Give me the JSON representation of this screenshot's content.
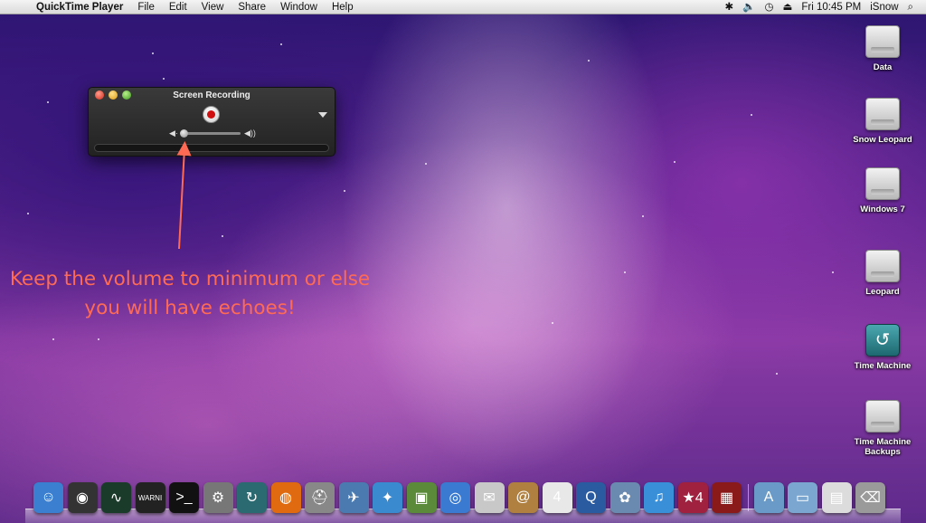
{
  "menubar": {
    "apple_icon": "apple-icon",
    "app_name": "QuickTime Player",
    "items": [
      "File",
      "Edit",
      "View",
      "Share",
      "Window",
      "Help"
    ],
    "status": {
      "clock": "Fri 10:45 PM",
      "user": "iSnow",
      "icons": [
        "gear-status-icon",
        "volume-icon",
        "time-machine-icon",
        "eject-icon",
        "spotlight-icon"
      ]
    }
  },
  "qt_window": {
    "title": "Screen Recording",
    "volume_level": 0
  },
  "annotation": {
    "text": "Keep the volume to minimum or else you will have echoes!",
    "color": "#ff6a55"
  },
  "desktop_icons": [
    {
      "label": "Data",
      "type": "disk"
    },
    {
      "label": "Snow Leopard",
      "type": "disk"
    },
    {
      "label": "Windows 7",
      "type": "disk"
    },
    {
      "label": "Leopard",
      "type": "disk"
    },
    {
      "label": "Time Machine",
      "type": "time-machine"
    },
    {
      "label": "Time Machine Backups",
      "type": "disk"
    }
  ],
  "dock": {
    "items": [
      {
        "name": "finder-icon",
        "glyph": "☺",
        "color": "#3a7fd0"
      },
      {
        "name": "dashboard-icon",
        "glyph": "◉",
        "color": "#333"
      },
      {
        "name": "activity-monitor-icon",
        "glyph": "∿",
        "color": "#1a3a2a"
      },
      {
        "name": "console-icon",
        "glyph": "WARNI",
        "color": "#222"
      },
      {
        "name": "terminal-icon",
        "glyph": ">_",
        "color": "#111"
      },
      {
        "name": "system-preferences-icon",
        "glyph": "⚙",
        "color": "#777"
      },
      {
        "name": "time-machine-dock-icon",
        "glyph": "↻",
        "color": "#2a6a70"
      },
      {
        "name": "firefox-icon",
        "glyph": "◍",
        "color": "#e06a10"
      },
      {
        "name": "disk-utility-icon",
        "glyph": "⛑",
        "color": "#888"
      },
      {
        "name": "mail-icon",
        "glyph": "✈",
        "color": "#4a7ab0"
      },
      {
        "name": "safari-icon",
        "glyph": "✦",
        "color": "#3a8ad0"
      },
      {
        "name": "screenshot-icon",
        "glyph": "▣",
        "color": "#5a8a3a"
      },
      {
        "name": "ichat-icon",
        "glyph": "◎",
        "color": "#3a7ad0"
      },
      {
        "name": "mail-stamp-icon",
        "glyph": "✉",
        "color": "#c8c8c8"
      },
      {
        "name": "address-book-icon",
        "glyph": "@",
        "color": "#b08040"
      },
      {
        "name": "ical-icon",
        "glyph": "4",
        "color": "#e8e8e8"
      },
      {
        "name": "quicktime-icon",
        "glyph": "Q",
        "color": "#2a5aa0"
      },
      {
        "name": "iphoto-icon",
        "glyph": "✿",
        "color": "#6a8ab0"
      },
      {
        "name": "itunes-icon",
        "glyph": "♫",
        "color": "#3a90d8"
      },
      {
        "name": "photoshop-icon",
        "glyph": "★4",
        "color": "#a02040"
      },
      {
        "name": "photo-booth-icon",
        "glyph": "▦",
        "color": "#8a1a1a"
      }
    ],
    "right_items": [
      {
        "name": "applications-folder-icon",
        "glyph": "A",
        "color": "#6a9ac8"
      },
      {
        "name": "documents-folder-icon",
        "glyph": "▭",
        "color": "#7aa6d0"
      },
      {
        "name": "zip-file-icon",
        "glyph": "▤",
        "color": "#dcdcdc"
      },
      {
        "name": "trash-icon",
        "glyph": "⌫",
        "color": "#9a9a9a"
      }
    ]
  }
}
